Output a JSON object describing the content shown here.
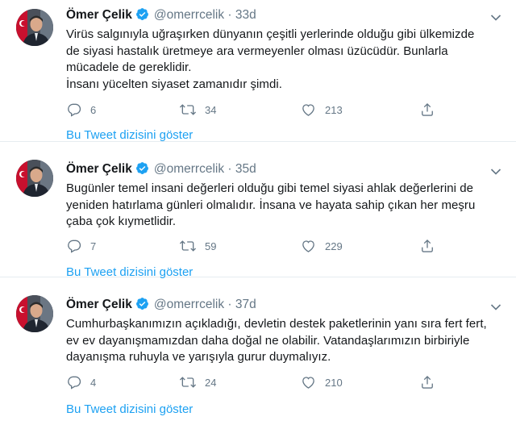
{
  "tweets": [
    {
      "name": "Ömer Çelik",
      "handle": "@omerrcelik",
      "dot": "·",
      "time": "33d",
      "text": "Virüs salgınıyla uğraşırken dünyanın çeşitli yerlerinde olduğu gibi ülkemizde\nde siyasi hastalık üretmeye ara vermeyenler olması üzücüdür. Bunlarla\nmücadele de gereklidir.\nİnsanı yücelten siyaset zamanıdır şimdi.",
      "replies": "6",
      "retweets": "34",
      "likes": "213",
      "thread_link": "Bu Tweet dizisini göster"
    },
    {
      "name": "Ömer Çelik",
      "handle": "@omerrcelik",
      "dot": "·",
      "time": "35d",
      "text": "Bugünler temel insani değerleri olduğu gibi temel siyasi ahlak değerlerini de\nyeniden hatırlama günleri olmalıdır. İnsana ve hayata sahip çıkan her meşru\nçaba çok kıymetlidir.",
      "replies": "7",
      "retweets": "59",
      "likes": "229",
      "thread_link": "Bu Tweet dizisini göster"
    },
    {
      "name": "Ömer Çelik",
      "handle": "@omerrcelik",
      "dot": "·",
      "time": "37d",
      "text": "Cumhurbaşkanımızın açıkladığı, devletin destek paketlerinin yanı sıra fert fert,\nev ev dayanışmamızdan daha doğal ne olabilir. Vatandaşlarımızın birbiriyle\ndayanışma ruhuyla ve yarışıyla gurur duymalıyız.",
      "replies": "4",
      "retweets": "24",
      "likes": "210",
      "thread_link": "Bu Tweet dizisini göster"
    }
  ],
  "colors": {
    "accent": "#1da1f2",
    "muted": "#657786",
    "text": "#14171a"
  },
  "icons": [
    "verified-badge-icon",
    "chevron-down-icon",
    "reply-icon",
    "retweet-icon",
    "like-icon",
    "share-icon"
  ]
}
